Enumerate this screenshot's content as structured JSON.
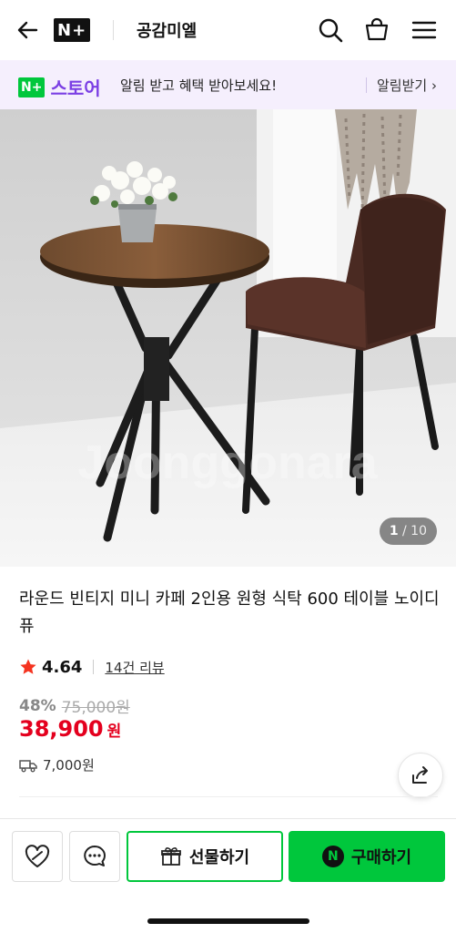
{
  "header": {
    "logo": "N+",
    "store_name": "공감미엘"
  },
  "banner": {
    "logo_n": "N+",
    "logo_store": "스토어",
    "text": "알림 받고 혜택 받아보세요!",
    "action": "알림받기 ›"
  },
  "gallery": {
    "current": "1",
    "total": "/ 10",
    "watermark": "Joonggonara"
  },
  "product": {
    "title": "라운드 빈티지 미니 카페 2인용 원형 식탁 600 테이블 노이디퓨",
    "rating": "4.64",
    "reviews": "14건 리뷰",
    "discount": "48%",
    "original_price": "75,000원",
    "price": "38,900",
    "currency": "원",
    "shipping": "7,000원"
  },
  "actions": {
    "gift_label": "선물하기",
    "buy_label": "구매하기",
    "buy_mark": "N"
  },
  "colors": {
    "naver_green": "#00c73c",
    "price_red": "#e4001e",
    "store_purple": "#7b3fe4",
    "star": "#f5331f"
  },
  "icons": [
    "back-arrow-icon",
    "search-icon",
    "cart-icon",
    "menu-icon",
    "share-icon",
    "truck-icon",
    "star-icon",
    "wishlist-heart-icon",
    "chat-icon",
    "gift-icon"
  ]
}
